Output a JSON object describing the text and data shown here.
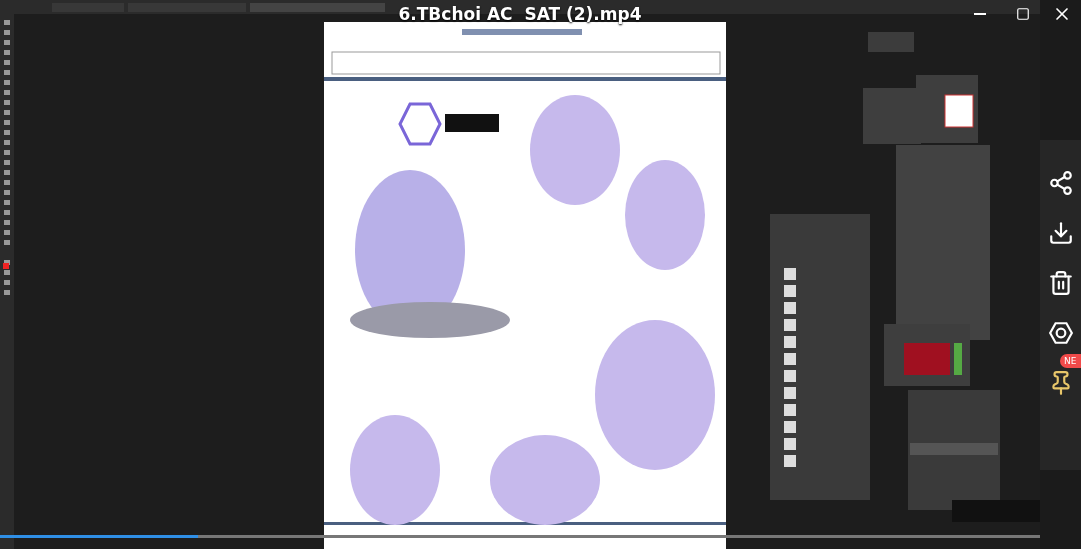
{
  "player": {
    "title": "6.TBchoi AC  SAT (2).mp4",
    "progress": {
      "level": 0.19
    }
  },
  "window_controls": [
    {
      "kind": "minimize"
    },
    {
      "kind": "restore"
    },
    {
      "kind": "close"
    }
  ],
  "sidebar": {
    "actions": [
      {
        "kind": "share"
      },
      {
        "kind": "download"
      },
      {
        "kind": "delete"
      },
      {
        "kind": "settings"
      },
      {
        "kind": "pin",
        "badge": "NE"
      }
    ]
  }
}
